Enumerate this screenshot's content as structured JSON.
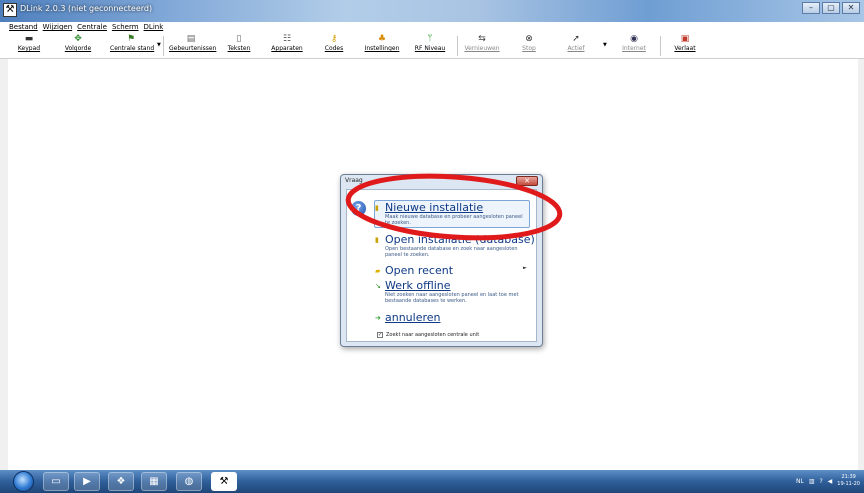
{
  "window": {
    "title": "DLink 2.0.3 (niet geconnecteerd)",
    "controls": [
      "–",
      "▢",
      "✕"
    ]
  },
  "menu": [
    "Bestand",
    "Wijzigen",
    "Centrale",
    "Scherm",
    "DLink"
  ],
  "toolbar": {
    "keypad": "Keypad",
    "volgorde": "Volgorde",
    "centrale_stand": "Centrale stand",
    "gebeurtenissen": "Gebeurtenissen",
    "teksten": "Teksten",
    "apparaten": "Apparaten",
    "codes": "Codes",
    "instellingen": "Instellingen",
    "rf_niveau": "RF Niveau",
    "vernieuwen": "Vernieuwen",
    "stop": "Stop",
    "actief": "Actief",
    "internet": "Internet",
    "verlaat": "Verlaat"
  },
  "dialog": {
    "title": "Vraag",
    "close": "✕",
    "options": {
      "nieuwe": {
        "label": "Nieuwe installatie",
        "desc": "Maak nieuwe database en probeer aangesloten paneel te zoeken."
      },
      "open_db": {
        "label": "Open installatie (database)",
        "desc": "Open bestaande database en zoek naar aangesloten paneel te zoeken."
      },
      "recent": {
        "label": "Open recent"
      },
      "offline": {
        "label": "Werk offline",
        "desc": "Niet zoeken naar aangesloten paneel en laat toe met bestaande databases te werken."
      },
      "annuleren": {
        "label": "annuleren"
      }
    },
    "checkbox_label": "Zoekt naar aangesloten centrale unit"
  },
  "highlight": {
    "color": "#e01a1a"
  },
  "taskbar": {
    "language": "NL",
    "time": "21:39",
    "date": "19-11-20"
  }
}
